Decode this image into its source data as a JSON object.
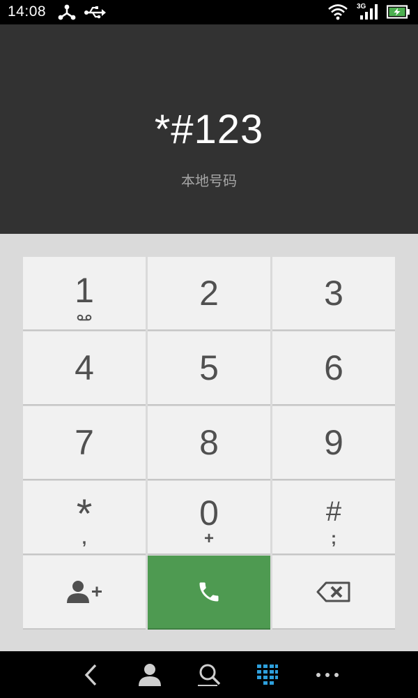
{
  "status_bar": {
    "time": "14:08",
    "network_type": "3G",
    "icons": [
      "nodes-icon",
      "usb-icon",
      "wifi-icon",
      "signal-icon",
      "battery-charging-icon"
    ]
  },
  "display": {
    "dialed_number": "*#123",
    "location_label": "本地号码"
  },
  "keypad": {
    "keys": [
      {
        "digit": "1",
        "sub_icon": "voicemail-icon"
      },
      {
        "digit": "2",
        "sub": ""
      },
      {
        "digit": "3",
        "sub": ""
      },
      {
        "digit": "4",
        "sub": ""
      },
      {
        "digit": "5",
        "sub": ""
      },
      {
        "digit": "6",
        "sub": ""
      },
      {
        "digit": "7",
        "sub": ""
      },
      {
        "digit": "8",
        "sub": ""
      },
      {
        "digit": "9",
        "sub": ""
      },
      {
        "digit": "*",
        "sub": ","
      },
      {
        "digit": "0",
        "sub": "+"
      },
      {
        "digit": "#",
        "sub": ";"
      }
    ],
    "actions": {
      "add_contact": "add-contact-icon",
      "call": "phone-icon",
      "backspace": "backspace-icon"
    },
    "call_color": "#4e9a51"
  },
  "nav_bar": {
    "items": [
      "back-icon",
      "contacts-icon",
      "search-icon",
      "dialpad-icon",
      "more-icon"
    ],
    "active": "dialpad-icon",
    "active_color": "#2ea0dd"
  }
}
